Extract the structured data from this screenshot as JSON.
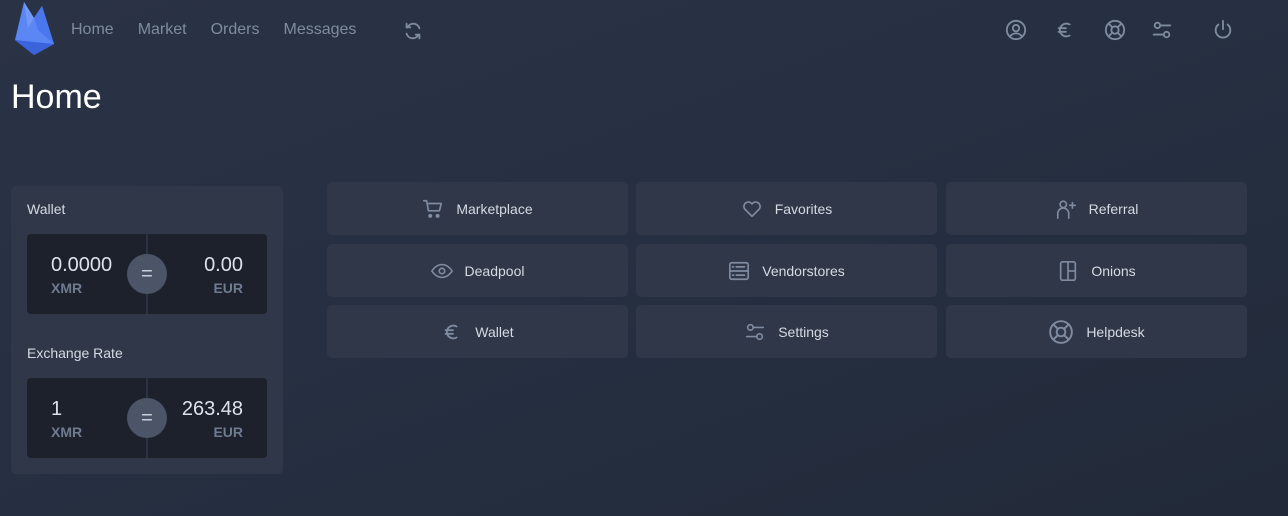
{
  "nav": {
    "items": [
      {
        "label": "Home"
      },
      {
        "label": "Market"
      },
      {
        "label": "Orders"
      },
      {
        "label": "Messages"
      }
    ],
    "refresh_icon": "refresh-icon",
    "right_icons": [
      "user-circle-icon",
      "euro-icon",
      "lifebuoy-icon",
      "sliders-icon",
      "power-icon"
    ]
  },
  "colors": {
    "logo_blue": "#4f7cf0",
    "logo_dark": "#3b63d8",
    "tile_bg": "#2f3748",
    "panel_dark": "#1c212c",
    "muted": "#7f8ba0"
  },
  "page": {
    "title": "Home"
  },
  "wallet": {
    "label": "Wallet",
    "left_value": "0.0000",
    "left_unit": "XMR",
    "equals": "=",
    "right_value": "0.00",
    "right_unit": "EUR"
  },
  "exchange": {
    "label": "Exchange Rate",
    "left_value": "1",
    "left_unit": "XMR",
    "equals": "=",
    "right_value": "263.48",
    "right_unit": "EUR"
  },
  "tiles": [
    {
      "label": "Marketplace",
      "icon": "cart-icon"
    },
    {
      "label": "Favorites",
      "icon": "heart-icon"
    },
    {
      "label": "Referral",
      "icon": "user-plus-icon"
    },
    {
      "label": "Deadpool",
      "icon": "eye-icon"
    },
    {
      "label": "Vendorstores",
      "icon": "server-icon"
    },
    {
      "label": "Onions",
      "icon": "layout-icon"
    },
    {
      "label": "Wallet",
      "icon": "euro-icon"
    },
    {
      "label": "Settings",
      "icon": "sliders-icon"
    },
    {
      "label": "Helpdesk",
      "icon": "lifebuoy-icon"
    }
  ]
}
